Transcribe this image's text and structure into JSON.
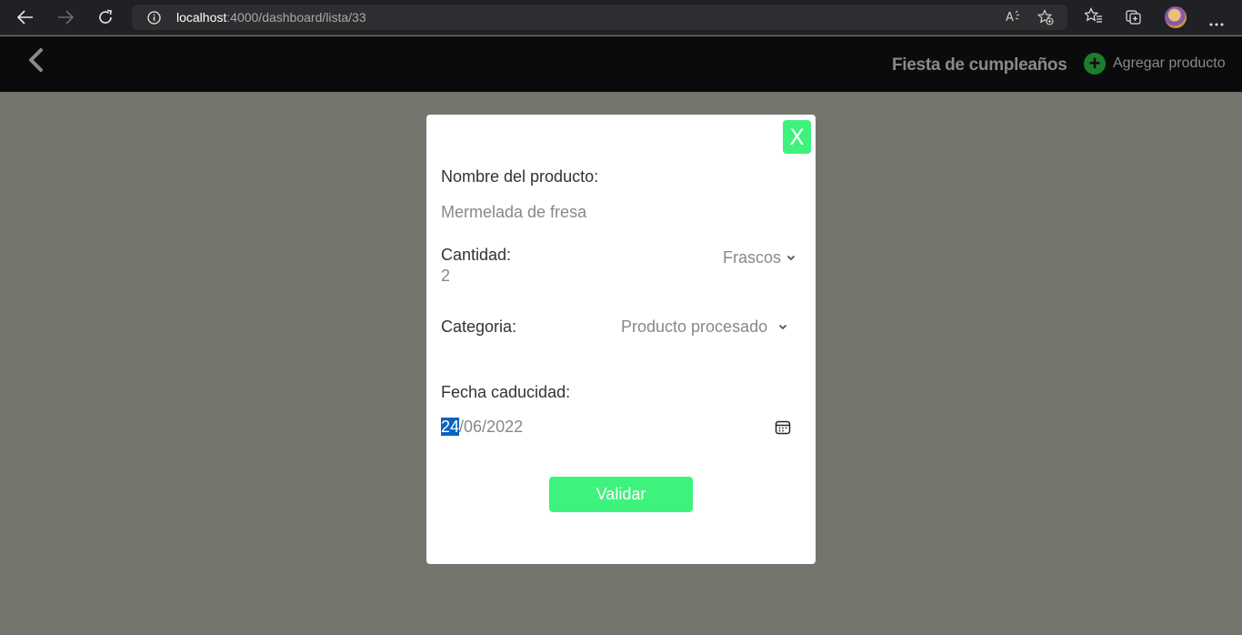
{
  "browser": {
    "url_host": "localhost",
    "url_path": ":4000/dashboard/lista/33",
    "icons": [
      "back-arrow-icon",
      "forward-arrow-icon",
      "reload-icon",
      "info-icon",
      "read-aloud-icon",
      "add-favorite-icon",
      "favorites-icon",
      "collections-icon",
      "profile-avatar",
      "more-icon"
    ]
  },
  "header": {
    "list_title": "Fiesta de cumpleaños",
    "add_product_label": "Agregar producto",
    "add_symbol": "+"
  },
  "modal": {
    "close_label": "X",
    "product_name_label": "Nombre del producto:",
    "product_name_value": "Mermelada de fresa",
    "quantity_label": "Cantidad:",
    "quantity_value": "2",
    "unit_value": "Frascos",
    "category_label": "Categoria:",
    "category_value": "Producto procesado",
    "expiry_label": "Fecha caducidad:",
    "expiry_day": "24",
    "expiry_rest": "/06/2022",
    "validate_label": "Validar"
  },
  "colors": {
    "accent_green": "#3df37d",
    "add_green": "#1e7c2b",
    "overlay": "#74756c",
    "header_bg": "#0b0b0d",
    "date_selection": "#0a64c2"
  }
}
